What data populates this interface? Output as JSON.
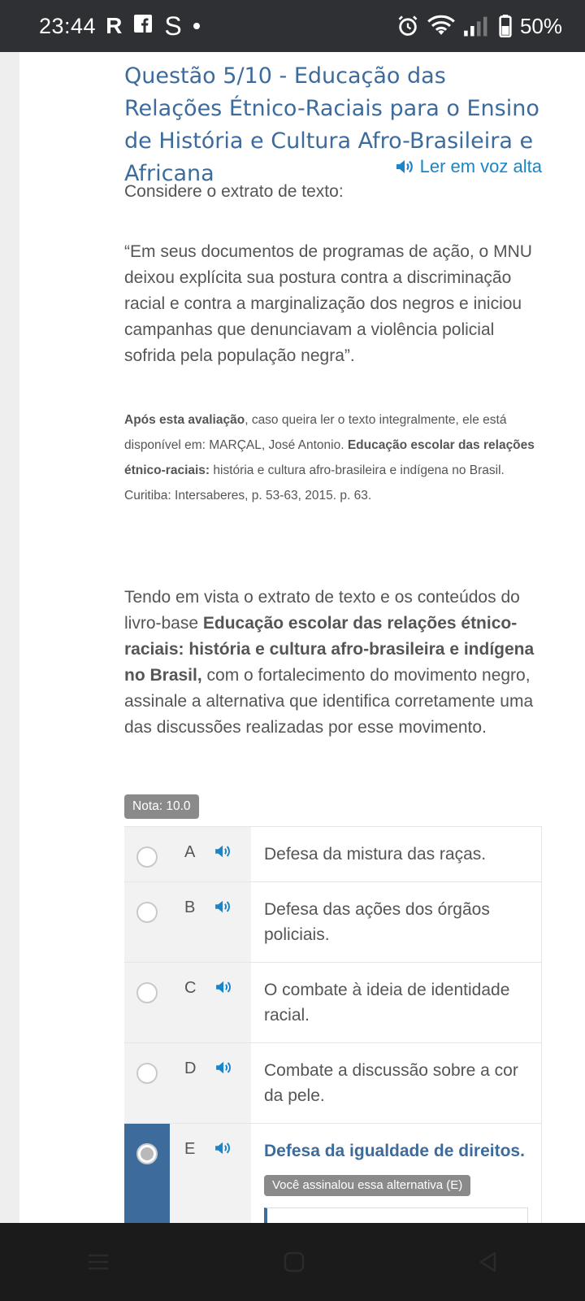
{
  "status_bar": {
    "time": "23:44",
    "left_icons": [
      "R",
      "f",
      "S"
    ],
    "battery": "50%"
  },
  "question": {
    "title": "Questão 5/10 - Educação das Relações Étnico-Raciais para o Ensino de História e Cultura Afro-Brasileira e Africana",
    "read_aloud": "Ler em voz alta",
    "intro": "Considere o extrato de texto:",
    "quote": "“Em seus documentos de programas de ação, o MNU deixou explícita sua postura contra a discriminação racial e contra a marginalização dos negros e iniciou campanhas que denunciavam a violência policial sofrida pela população negra”.",
    "reference_bold1": "Após esta avaliação",
    "reference_text1": ", caso queira ler o texto integralmente, ele está disponível em: MARÇAL, José Antonio. ",
    "reference_bold2": "Educação escolar das relações étnico-raciais:",
    "reference_text2": " história e cultura afro-brasileira e indígena no Brasil. Curitiba: Intersaberes, p. 53-63, 2015. p. 63.",
    "prompt_text1": "Tendo em vista o extrato de texto e os conteúdos do livro-base ",
    "prompt_bold": "Educação escolar das relações étnico-raciais: história e cultura afro-brasileira e indígena no Brasil,",
    "prompt_text2": " com o fortalecimento do movimento negro, assinale a alternativa que identifica corretamente uma das discussões realizadas por esse movimento.",
    "grade": "Nota: 10.0"
  },
  "options": [
    {
      "letter": "A",
      "text": "Defesa da mistura das raças."
    },
    {
      "letter": "B",
      "text": "Defesa das ações dos órgãos policiais."
    },
    {
      "letter": "C",
      "text": "O combate à ideia de identidade racial."
    },
    {
      "letter": "D",
      "text": "Combate a discussão sobre a cor da pele."
    },
    {
      "letter": "E",
      "text": "Defesa da igualdade de direitos.",
      "chosen_label": "Você assinalou essa alternativa (E)"
    }
  ],
  "colors": {
    "accent": "#3d6b9c",
    "speaker": "#1a85c8",
    "badge": "#8a8a8a"
  }
}
